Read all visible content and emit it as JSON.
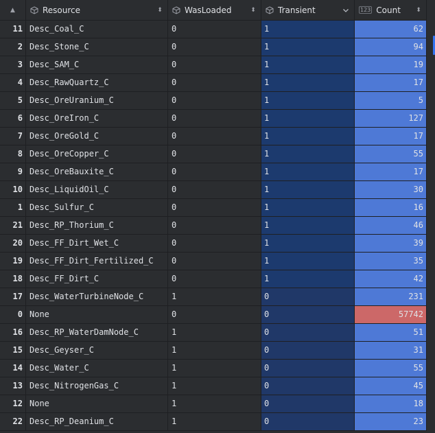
{
  "headers": {
    "sort_all_icon": "sort-arrows",
    "resource": "Resource",
    "wasloaded": "WasLoaded",
    "transient": "Transient",
    "count": "Count",
    "count_type_badge": "123"
  },
  "colors": {
    "transient_true_bg": "#1c3a6e",
    "transient_false_bg": "#203868",
    "count_bg": "#4e79d6",
    "count_max_bg": "#cc6868"
  },
  "rows": [
    {
      "id": "11",
      "resource": "Desc_Coal_C",
      "wasloaded": "0",
      "transient": "1",
      "count": "62"
    },
    {
      "id": "2",
      "resource": "Desc_Stone_C",
      "wasloaded": "0",
      "transient": "1",
      "count": "94"
    },
    {
      "id": "3",
      "resource": "Desc_SAM_C",
      "wasloaded": "0",
      "transient": "1",
      "count": "19"
    },
    {
      "id": "4",
      "resource": "Desc_RawQuartz_C",
      "wasloaded": "0",
      "transient": "1",
      "count": "17"
    },
    {
      "id": "5",
      "resource": "Desc_OreUranium_C",
      "wasloaded": "0",
      "transient": "1",
      "count": "5"
    },
    {
      "id": "6",
      "resource": "Desc_OreIron_C",
      "wasloaded": "0",
      "transient": "1",
      "count": "127"
    },
    {
      "id": "7",
      "resource": "Desc_OreGold_C",
      "wasloaded": "0",
      "transient": "1",
      "count": "17"
    },
    {
      "id": "8",
      "resource": "Desc_OreCopper_C",
      "wasloaded": "0",
      "transient": "1",
      "count": "55"
    },
    {
      "id": "9",
      "resource": "Desc_OreBauxite_C",
      "wasloaded": "0",
      "transient": "1",
      "count": "17"
    },
    {
      "id": "10",
      "resource": "Desc_LiquidOil_C",
      "wasloaded": "0",
      "transient": "1",
      "count": "30"
    },
    {
      "id": "1",
      "resource": "Desc_Sulfur_C",
      "wasloaded": "0",
      "transient": "1",
      "count": "16"
    },
    {
      "id": "21",
      "resource": "Desc_RP_Thorium_C",
      "wasloaded": "0",
      "transient": "1",
      "count": "46"
    },
    {
      "id": "20",
      "resource": "Desc_FF_Dirt_Wet_C",
      "wasloaded": "0",
      "transient": "1",
      "count": "39"
    },
    {
      "id": "19",
      "resource": "Desc_FF_Dirt_Fertilized_C",
      "wasloaded": "0",
      "transient": "1",
      "count": "35"
    },
    {
      "id": "18",
      "resource": "Desc_FF_Dirt_C",
      "wasloaded": "0",
      "transient": "1",
      "count": "42"
    },
    {
      "id": "17",
      "resource": "Desc_WaterTurbineNode_C",
      "wasloaded": "1",
      "transient": "0",
      "count": "231"
    },
    {
      "id": "0",
      "resource": "None",
      "wasloaded": "0",
      "transient": "0",
      "count": "57742",
      "highlight": true
    },
    {
      "id": "16",
      "resource": "Desc_RP_WaterDamNode_C",
      "wasloaded": "1",
      "transient": "0",
      "count": "51"
    },
    {
      "id": "15",
      "resource": "Desc_Geyser_C",
      "wasloaded": "1",
      "transient": "0",
      "count": "31"
    },
    {
      "id": "14",
      "resource": "Desc_Water_C",
      "wasloaded": "1",
      "transient": "0",
      "count": "55"
    },
    {
      "id": "13",
      "resource": "Desc_NitrogenGas_C",
      "wasloaded": "1",
      "transient": "0",
      "count": "45"
    },
    {
      "id": "12",
      "resource": "None",
      "wasloaded": "1",
      "transient": "0",
      "count": "18"
    },
    {
      "id": "22",
      "resource": "Desc_RP_Deanium_C",
      "wasloaded": "1",
      "transient": "0",
      "count": "23"
    }
  ]
}
